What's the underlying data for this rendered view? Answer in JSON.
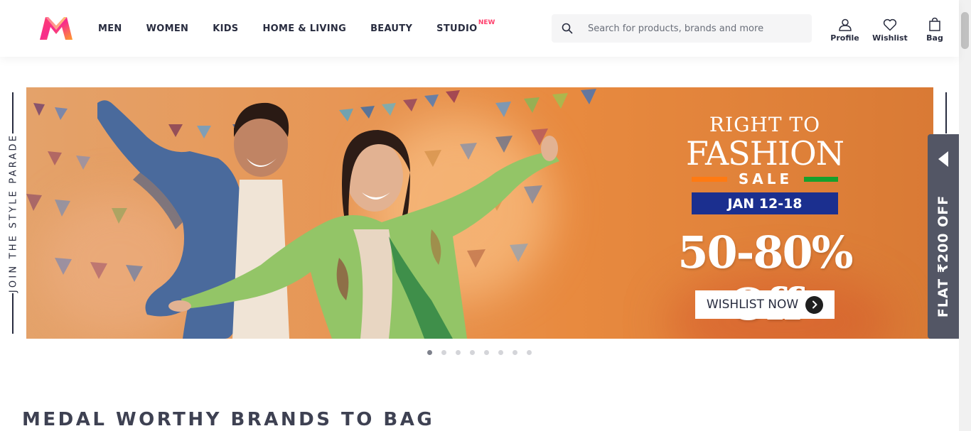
{
  "brand": {
    "logo": "myntra-logo-icon",
    "accent": "#ff3f6c"
  },
  "nav": {
    "items": [
      {
        "label": "MEN"
      },
      {
        "label": "WOMEN"
      },
      {
        "label": "KIDS"
      },
      {
        "label": "HOME & LIVING"
      },
      {
        "label": "BEAUTY"
      },
      {
        "label": "STUDIO",
        "badge": "NEW"
      }
    ]
  },
  "search": {
    "placeholder": "Search for products, brands and more",
    "icon": "search-icon"
  },
  "actions": {
    "profile": {
      "label": "Profile",
      "icon": "profile-icon"
    },
    "wishlist": {
      "label": "Wishlist",
      "icon": "heart-icon"
    },
    "bag": {
      "label": "Bag",
      "icon": "bag-icon"
    }
  },
  "side": {
    "tagline": "JOIN THE STYLE PARADE"
  },
  "banner": {
    "headline_top": "RIGHT TO",
    "headline_main": "FASHION",
    "sale_label": "SALE",
    "dates": "JAN 12-18",
    "discount": "50-80% Off",
    "cta_label": "WISHLIST NOW",
    "cta_icon": "chevron-right-icon",
    "colors": {
      "date_bg": "#1b2f8f",
      "flag_orange": "#ff7a12",
      "flag_green": "#17a02c"
    }
  },
  "flat_offer": {
    "text": "FLAT ₹200 OFF",
    "icon": "caret-left-icon"
  },
  "carousel": {
    "total": 8,
    "active_index": 0
  },
  "sections": {
    "brands_title": "MEDAL WORTHY BRANDS TO BAG"
  }
}
